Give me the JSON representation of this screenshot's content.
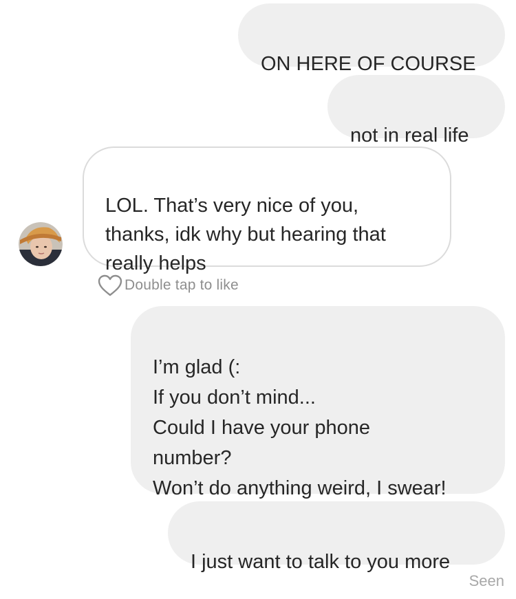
{
  "messages": [
    {
      "direction": "outgoing",
      "text": "ON HERE OF COURSE"
    },
    {
      "direction": "outgoing",
      "text": "not in real life"
    },
    {
      "direction": "incoming",
      "text": "LOL. That’s very nice of you,\nthanks, idk why but hearing that\nreally helps"
    },
    {
      "direction": "outgoing",
      "text": "I’m glad (:\nIf you don’t mind...\nCould I have your phone\nnumber?\nWon’t do anything weird, I swear!"
    },
    {
      "direction": "outgoing",
      "text": "I just want to talk to you more"
    }
  ],
  "like_hint": "Double tap to like",
  "status": "Seen",
  "icons": {
    "like": "heart-outline-icon",
    "avatar": "contact-avatar"
  },
  "colors": {
    "outgoing_bubble": "#efefef",
    "incoming_border": "#dbdbdb",
    "text": "#262626",
    "secondary_text": "#8e8e8e"
  }
}
